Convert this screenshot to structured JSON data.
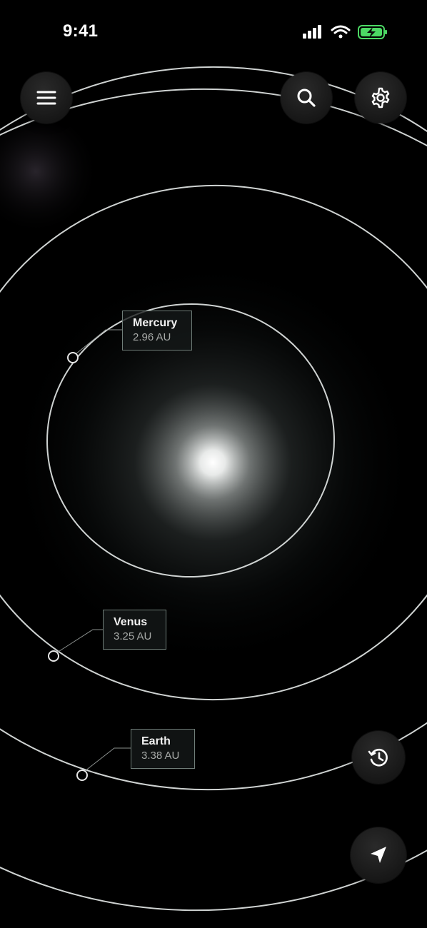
{
  "status_bar": {
    "time": "9:41",
    "icons": [
      "cellular-signal-icon",
      "wifi-icon",
      "battery-charging-icon"
    ],
    "battery_color": "#4cd964"
  },
  "toolbar": {
    "menu_icon": "hamburger-menu-icon",
    "search_icon": "search-icon",
    "settings_icon": "gear-icon"
  },
  "planets": [
    {
      "name": "Mercury",
      "distance": "2.96 AU"
    },
    {
      "name": "Venus",
      "distance": "3.25 AU"
    },
    {
      "name": "Earth",
      "distance": "3.38 AU"
    }
  ],
  "controls": {
    "history_icon": "history-icon",
    "locate_icon": "location-arrow-icon"
  },
  "colors": {
    "background": "#000000",
    "orbit": "#cfd3d2",
    "label_border": "#6f7d78",
    "sun_glow": "#ffffff"
  }
}
